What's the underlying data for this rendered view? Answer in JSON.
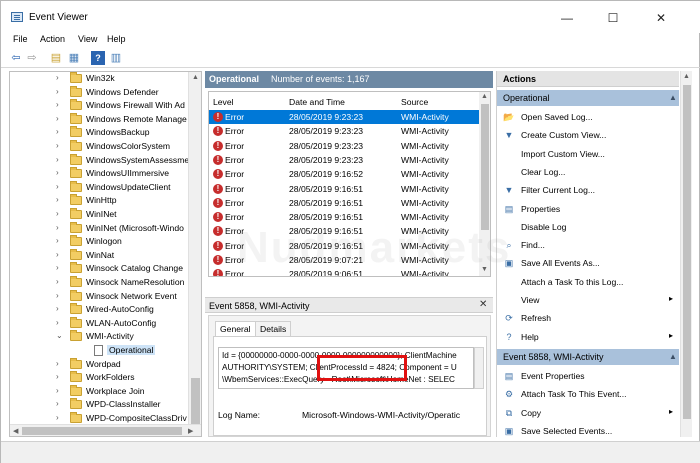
{
  "window": {
    "title": "Event Viewer",
    "controls": {
      "minimize": "—",
      "maximize": "☐",
      "close": "✕"
    }
  },
  "menu": [
    "File",
    "Action",
    "View",
    "Help"
  ],
  "toolbar": {
    "icons": [
      "back-arrow-icon",
      "forward-arrow-icon",
      "folder-up-icon",
      "show-hide-tree-icon",
      "help-icon",
      "properties-icon"
    ]
  },
  "tree": {
    "items": [
      {
        "label": "Win32k",
        "expand": "›"
      },
      {
        "label": "Windows Defender",
        "expand": "›"
      },
      {
        "label": "Windows Firewall With Ad",
        "expand": "›"
      },
      {
        "label": "Windows Remote Manage",
        "expand": "›"
      },
      {
        "label": "WindowsBackup",
        "expand": "›"
      },
      {
        "label": "WindowsColorSystem",
        "expand": "›"
      },
      {
        "label": "WindowsSystemAssessme",
        "expand": "›"
      },
      {
        "label": "WindowsUIImmersive",
        "expand": "›"
      },
      {
        "label": "WindowsUpdateClient",
        "expand": "›"
      },
      {
        "label": "WinHttp",
        "expand": "›"
      },
      {
        "label": "WinINet",
        "expand": "›"
      },
      {
        "label": "WinINet (Microsoft-Windo",
        "expand": "›"
      },
      {
        "label": "Winlogon",
        "expand": "›"
      },
      {
        "label": "WinNat",
        "expand": "›"
      },
      {
        "label": "Winsock Catalog Change",
        "expand": "›"
      },
      {
        "label": "Winsock NameResolution",
        "expand": "›"
      },
      {
        "label": "Winsock Network Event",
        "expand": "›"
      },
      {
        "label": "Wired-AutoConfig",
        "expand": "›"
      },
      {
        "label": "WLAN-AutoConfig",
        "expand": "›"
      },
      {
        "label": "WMI-Activity",
        "expand": "⌄"
      },
      {
        "label": "Operational",
        "expand": ""
      },
      {
        "label": "Wordpad",
        "expand": "›"
      },
      {
        "label": "WorkFolders",
        "expand": "›"
      },
      {
        "label": "Workplace Join",
        "expand": "›"
      },
      {
        "label": "WPD-ClassInstaller",
        "expand": "›"
      },
      {
        "label": "WPD-CompositeClassDriv",
        "expand": "›"
      }
    ]
  },
  "log": {
    "name": "Operational",
    "count_label": "Number of events: 1,167",
    "columns": [
      "Level",
      "Date and Time",
      "Source"
    ],
    "events": [
      {
        "level": "Error",
        "datetime": "28/05/2019 9:23:23",
        "source": "WMI-Activity"
      },
      {
        "level": "Error",
        "datetime": "28/05/2019 9:23:23",
        "source": "WMI-Activity"
      },
      {
        "level": "Error",
        "datetime": "28/05/2019 9:23:23",
        "source": "WMI-Activity"
      },
      {
        "level": "Error",
        "datetime": "28/05/2019 9:23:23",
        "source": "WMI-Activity"
      },
      {
        "level": "Error",
        "datetime": "28/05/2019 9:16:52",
        "source": "WMI-Activity"
      },
      {
        "level": "Error",
        "datetime": "28/05/2019 9:16:51",
        "source": "WMI-Activity"
      },
      {
        "level": "Error",
        "datetime": "28/05/2019 9:16:51",
        "source": "WMI-Activity"
      },
      {
        "level": "Error",
        "datetime": "28/05/2019 9:16:51",
        "source": "WMI-Activity"
      },
      {
        "level": "Error",
        "datetime": "28/05/2019 9:16:51",
        "source": "WMI-Activity"
      },
      {
        "level": "Error",
        "datetime": "28/05/2019 9:16:51",
        "source": "WMI-Activity"
      },
      {
        "level": "Error",
        "datetime": "28/05/2019 9:07:21",
        "source": "WMI-Activity"
      },
      {
        "level": "Error",
        "datetime": "28/05/2019 9:06:51",
        "source": "WMI-Activity"
      }
    ],
    "selected_index": 0
  },
  "detail": {
    "title": "Event 5858, WMI-Activity",
    "close": "✕",
    "tabs": [
      "General",
      "Details"
    ],
    "active_tab": "General",
    "xml_lines": [
      "Id = {00000000-0000-0000-0000-000000000000}; ClientMachine",
      "AUTHORITY\\SYSTEM; ClientProcessId = 4824; Component = U",
      "\\WbemServices::ExecQuery - Root\\Microsoft\\HomeNet : SELEC"
    ],
    "log_name_label": "Log Name:",
    "log_name_value": "Microsoft-Windows-WMI-Activity/Operatic"
  },
  "actions": {
    "title": "Actions",
    "section1": {
      "title": "Operational",
      "items": [
        {
          "label": "Open Saved Log...",
          "icon": "open-log-icon",
          "glyph": "📂"
        },
        {
          "label": "Create Custom View...",
          "icon": "filter-icon",
          "glyph": "▼"
        },
        {
          "label": "Import Custom View...",
          "icon": "import-icon",
          "glyph": ""
        },
        {
          "label": "Clear Log...",
          "icon": "clear-log-icon",
          "glyph": ""
        },
        {
          "label": "Filter Current Log...",
          "icon": "filter-icon",
          "glyph": "▼"
        },
        {
          "label": "Properties",
          "icon": "properties-icon",
          "glyph": "▤"
        },
        {
          "label": "Disable Log",
          "icon": "disable-icon",
          "glyph": ""
        },
        {
          "label": "Find...",
          "icon": "binoculars-icon",
          "glyph": "⌕"
        },
        {
          "label": "Save All Events As...",
          "icon": "save-icon",
          "glyph": "▣"
        },
        {
          "label": "Attach a Task To this Log...",
          "icon": "task-icon",
          "glyph": ""
        },
        {
          "label": "View",
          "icon": "view-icon",
          "glyph": "",
          "submenu": "▸"
        },
        {
          "label": "Refresh",
          "icon": "refresh-icon",
          "glyph": "⟳"
        },
        {
          "label": "Help",
          "icon": "help-icon",
          "glyph": "?",
          "submenu": "▸"
        }
      ]
    },
    "section2": {
      "title": "Event 5858, WMI-Activity",
      "items": [
        {
          "label": "Event Properties",
          "icon": "event-properties-icon",
          "glyph": "▤"
        },
        {
          "label": "Attach Task To This Event...",
          "icon": "task-icon",
          "glyph": "⚙"
        },
        {
          "label": "Copy",
          "icon": "copy-icon",
          "glyph": "⧉",
          "submenu": "▸"
        },
        {
          "label": "Save Selected Events...",
          "icon": "save-icon",
          "glyph": "▣"
        }
      ]
    }
  },
  "colors": {
    "header_bar": "#6d89a4",
    "selection": "#0078d7",
    "section_header": "#a9c1db",
    "highlight_box": "#e01010",
    "error_icon": "#c62d2d"
  },
  "watermark": "Nudmarkets"
}
